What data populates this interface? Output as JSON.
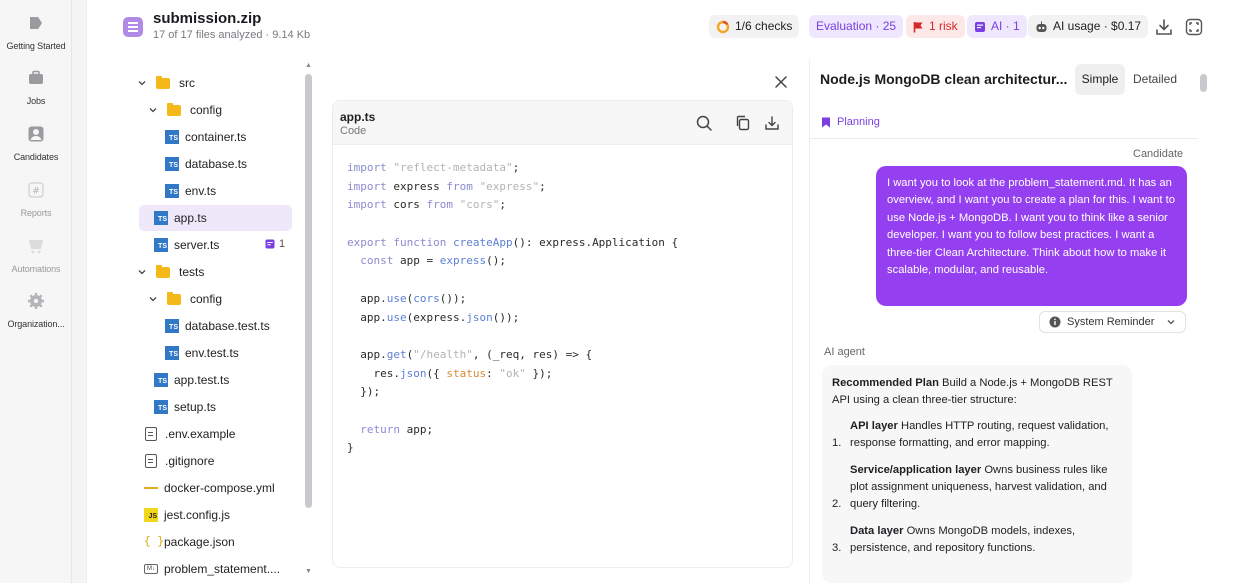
{
  "nav": {
    "items": [
      {
        "label": "Getting Started"
      },
      {
        "label": "Jobs"
      },
      {
        "label": "Candidates"
      },
      {
        "label": "Reports"
      },
      {
        "label": "Automations"
      },
      {
        "label": "Organization..."
      }
    ]
  },
  "header": {
    "title": "submission.zip",
    "subtitle": "17 of 17 files analyzed · 9.14 Kb",
    "checks": "1/6 checks",
    "evaluation": "Evaluation · 25",
    "risk": "1 risk",
    "ai": "AI · 1",
    "ai_usage": "AI usage · $0.17"
  },
  "tree": {
    "nodes": [
      {
        "label": "src",
        "type": "folder"
      },
      {
        "label": "config",
        "type": "folder"
      },
      {
        "label": "container.ts",
        "type": "ts"
      },
      {
        "label": "database.ts",
        "type": "ts"
      },
      {
        "label": "env.ts",
        "type": "ts"
      },
      {
        "label": "app.ts",
        "type": "ts"
      },
      {
        "label": "server.ts",
        "type": "ts"
      },
      {
        "label": "tests",
        "type": "folder"
      },
      {
        "label": "config",
        "type": "folder"
      },
      {
        "label": "database.test.ts",
        "type": "ts"
      },
      {
        "label": "env.test.ts",
        "type": "ts"
      },
      {
        "label": "app.test.ts",
        "type": "ts"
      },
      {
        "label": "setup.ts",
        "type": "ts"
      },
      {
        "label": ".env.example",
        "type": "text"
      },
      {
        "label": ".gitignore",
        "type": "text"
      },
      {
        "label": "docker-compose.yml",
        "type": "yaml"
      },
      {
        "label": "jest.config.js",
        "type": "js"
      },
      {
        "label": "package.json",
        "type": "json"
      },
      {
        "label": "problem_statement....",
        "type": "md"
      }
    ],
    "server_comments": "1",
    "ts_icon": "TS",
    "js_icon": "JS",
    "json_icon": "{ }",
    "md_icon": "M↓"
  },
  "code": {
    "filename": "app.ts",
    "kind": "Code",
    "lines": [
      "import \"reflect-metadata\";",
      "import express from \"express\";",
      "import cors from \"cors\";",
      "",
      "export function createApp(): express.Application {",
      "  const app = express();",
      "",
      "  app.use(cors());",
      "  app.use(express.json());",
      "",
      "  app.get(\"/health\", (_req, res) => {",
      "    res.json({ status: \"ok\" });",
      "  });",
      "",
      "  return app;",
      "}"
    ]
  },
  "chat": {
    "title": "Node.js MongoDB clean architectur...",
    "tab_simple": "Simple",
    "tab_detailed": "Detailed",
    "planning": "Planning",
    "candidate_label": "Candidate",
    "user_message": "I want you to look at the problem_statement.md. It has an overview, and I want you to create a plan for this. I want to use Node.js + MongoDB. I want you to think like a senior developer. I want you to follow best practices. I want a three-tier Clean Architecture. Think about how to make it scalable, modular, and reusable.",
    "system_reminder": "System Reminder",
    "ai_label": "AI agent",
    "ai_intro_bold": "Recommended Plan",
    "ai_intro": " Build a Node.js + MongoDB REST API using a clean three-tier structure:",
    "ai_items": [
      {
        "num": "1.",
        "bold": "API layer",
        "text": " Handles HTTP routing, request validation, response formatting, and error mapping."
      },
      {
        "num": "2.",
        "bold": "Service/application layer",
        "text": " Owns business rules like plot assignment uniqueness, harvest validation, and query filtering."
      },
      {
        "num": "3.",
        "bold": "Data layer",
        "text": " Owns MongoDB models, indexes, persistence, and repository functions."
      }
    ]
  },
  "colors": {
    "accent": "#9540f0",
    "risk": "#d62828",
    "folder": "#f5b819",
    "ts": "#3178c6"
  }
}
